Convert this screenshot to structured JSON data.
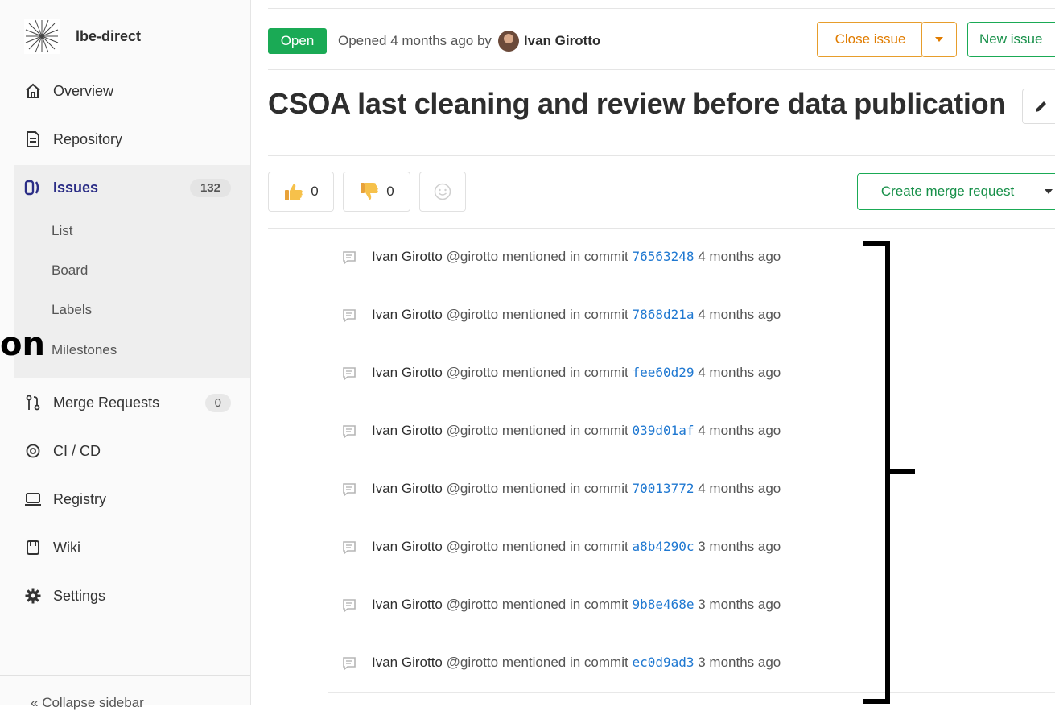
{
  "sidebar": {
    "project_name": "lbe-direct",
    "items": [
      {
        "label": "Overview",
        "icon": "home-icon"
      },
      {
        "label": "Repository",
        "icon": "document-icon"
      },
      {
        "label": "Issues",
        "icon": "issues-icon",
        "badge": "132"
      },
      {
        "label": "Merge Requests",
        "icon": "merge-request-icon",
        "badge": "0"
      },
      {
        "label": "CI / CD",
        "icon": "rocket-icon"
      },
      {
        "label": "Registry",
        "icon": "laptop-icon"
      },
      {
        "label": "Wiki",
        "icon": "book-icon"
      },
      {
        "label": "Settings",
        "icon": "gear-icon"
      }
    ],
    "sub_items": [
      "List",
      "Board",
      "Labels",
      "Milestones"
    ],
    "collapse_label": "Collapse sidebar"
  },
  "overlay_text": "on",
  "issue": {
    "status": "Open",
    "opened_text": "Opened 4 months ago by",
    "author": "Ivan Girotto",
    "title": "CSOA last cleaning and review before data publication",
    "close_button": "Close issue",
    "new_button": "New issue",
    "thumbs_up_count": "0",
    "thumbs_down_count": "0",
    "merge_request_button": "Create merge request"
  },
  "notes": [
    {
      "author": "Ivan Girotto",
      "handle": "@girotto",
      "action": "mentioned in commit",
      "sha": "76563248",
      "time": "4 months ago"
    },
    {
      "author": "Ivan Girotto",
      "handle": "@girotto",
      "action": "mentioned in commit",
      "sha": "7868d21a",
      "time": "4 months ago"
    },
    {
      "author": "Ivan Girotto",
      "handle": "@girotto",
      "action": "mentioned in commit",
      "sha": "fee60d29",
      "time": "4 months ago"
    },
    {
      "author": "Ivan Girotto",
      "handle": "@girotto",
      "action": "mentioned in commit",
      "sha": "039d01af",
      "time": "4 months ago"
    },
    {
      "author": "Ivan Girotto",
      "handle": "@girotto",
      "action": "mentioned in commit",
      "sha": "70013772",
      "time": "4 months ago"
    },
    {
      "author": "Ivan Girotto",
      "handle": "@girotto",
      "action": "mentioned in commit",
      "sha": "a8b4290c",
      "time": "3 months ago"
    },
    {
      "author": "Ivan Girotto",
      "handle": "@girotto",
      "action": "mentioned in commit",
      "sha": "9b8e468e",
      "time": "3 months ago"
    },
    {
      "author": "Ivan Girotto",
      "handle": "@girotto",
      "action": "mentioned in commit",
      "sha": "ec0d9ad3",
      "time": "3 months ago"
    }
  ],
  "colors": {
    "open_badge": "#1aaa55",
    "close_accent": "#e07c00",
    "new_accent": "#1aaa55",
    "active_nav": "#2b2d86",
    "commit_link": "#1f78d1"
  }
}
